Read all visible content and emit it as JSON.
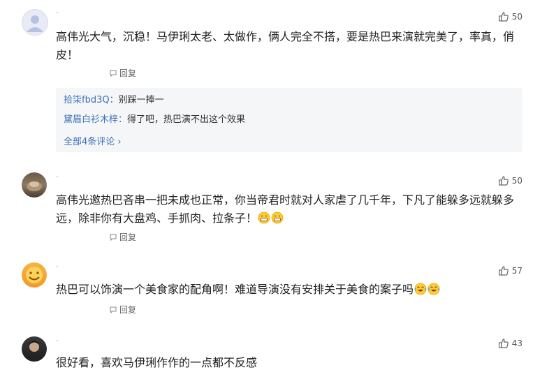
{
  "comments": [
    {
      "text": "高伟光大气，沉稳！马伊琍太老、太做作，俩人完全不搭，要是热巴来演就完美了，率真，俏皮！",
      "likes": "50",
      "reply_label": "回复",
      "replies": [
        {
          "name": "拾柒fbd3Q：",
          "text": "别踩一捧一"
        },
        {
          "name": "黛眉白衫木梓：",
          "text": "得了吧，热巴演不出这个效果"
        }
      ],
      "all_replies_label": "全部4条评论 ›"
    },
    {
      "text": "高伟光邀热巴吝串一把未成也正常，你当帝君时就对人家虐了几千年，下凡了能躲多远就躲多远，除非你有大盘鸡、手抓肉、拉条子！",
      "likes": "50",
      "reply_label": "回复"
    },
    {
      "text": "热巴可以饰演一个美食家的配角啊！难道导演没有安排关于美食的案子吗",
      "likes": "57",
      "reply_label": "回复"
    },
    {
      "text": "很好看，喜欢马伊琍作作的一点都不反感",
      "likes": "43"
    }
  ],
  "colors": {
    "link": "#3a6fb8",
    "reply_box_bg": "#f5f6f8"
  },
  "icons": [
    "thumbs-up-icon",
    "reply-icon",
    "grin-emoji-icon",
    "laugh-cry-emoji-icon",
    "chevron-right-icon"
  ]
}
